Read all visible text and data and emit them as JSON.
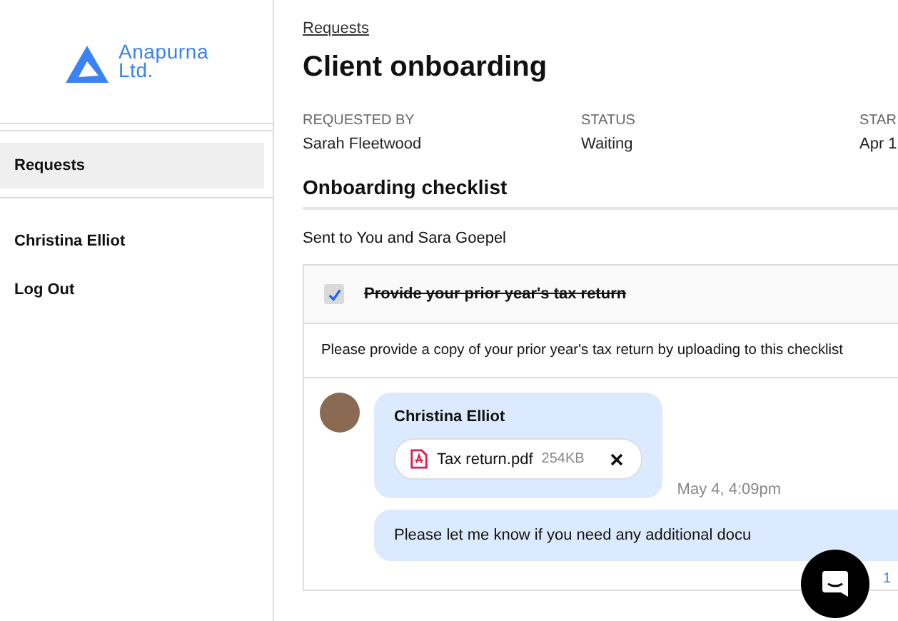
{
  "sidebar": {
    "logo": {
      "line1": "Anapurna",
      "line2": "Ltd."
    },
    "items": [
      {
        "label": "Requests",
        "selected": true
      },
      {
        "label": "Christina Elliot",
        "selected": false
      },
      {
        "label": "Log Out",
        "selected": false
      }
    ]
  },
  "breadcrumb": "Requests",
  "title": "Client onboarding",
  "meta": [
    {
      "label": "REQUESTED BY",
      "value": "Sarah Fleetwood"
    },
    {
      "label": "STATUS",
      "value": "Waiting"
    },
    {
      "label": "STAR",
      "value": "Apr 1"
    }
  ],
  "checklist": {
    "heading": "Onboarding checklist",
    "sent_to": "Sent to You and Sara Goepel",
    "items": [
      {
        "label": "Provide your prior year's tax return",
        "checked": true,
        "description": "Please provide a copy of your prior year's tax return by uploading to this checklist",
        "comments": [
          {
            "kind": "attachment",
            "author": "Christina Elliot",
            "file_name": "Tax return.pdf",
            "file_size": "254KB",
            "time": "May 4, 4:09pm"
          },
          {
            "kind": "text",
            "text": "Please let me know if you need any additional docu",
            "reaction_count": "1"
          }
        ]
      }
    ]
  }
}
